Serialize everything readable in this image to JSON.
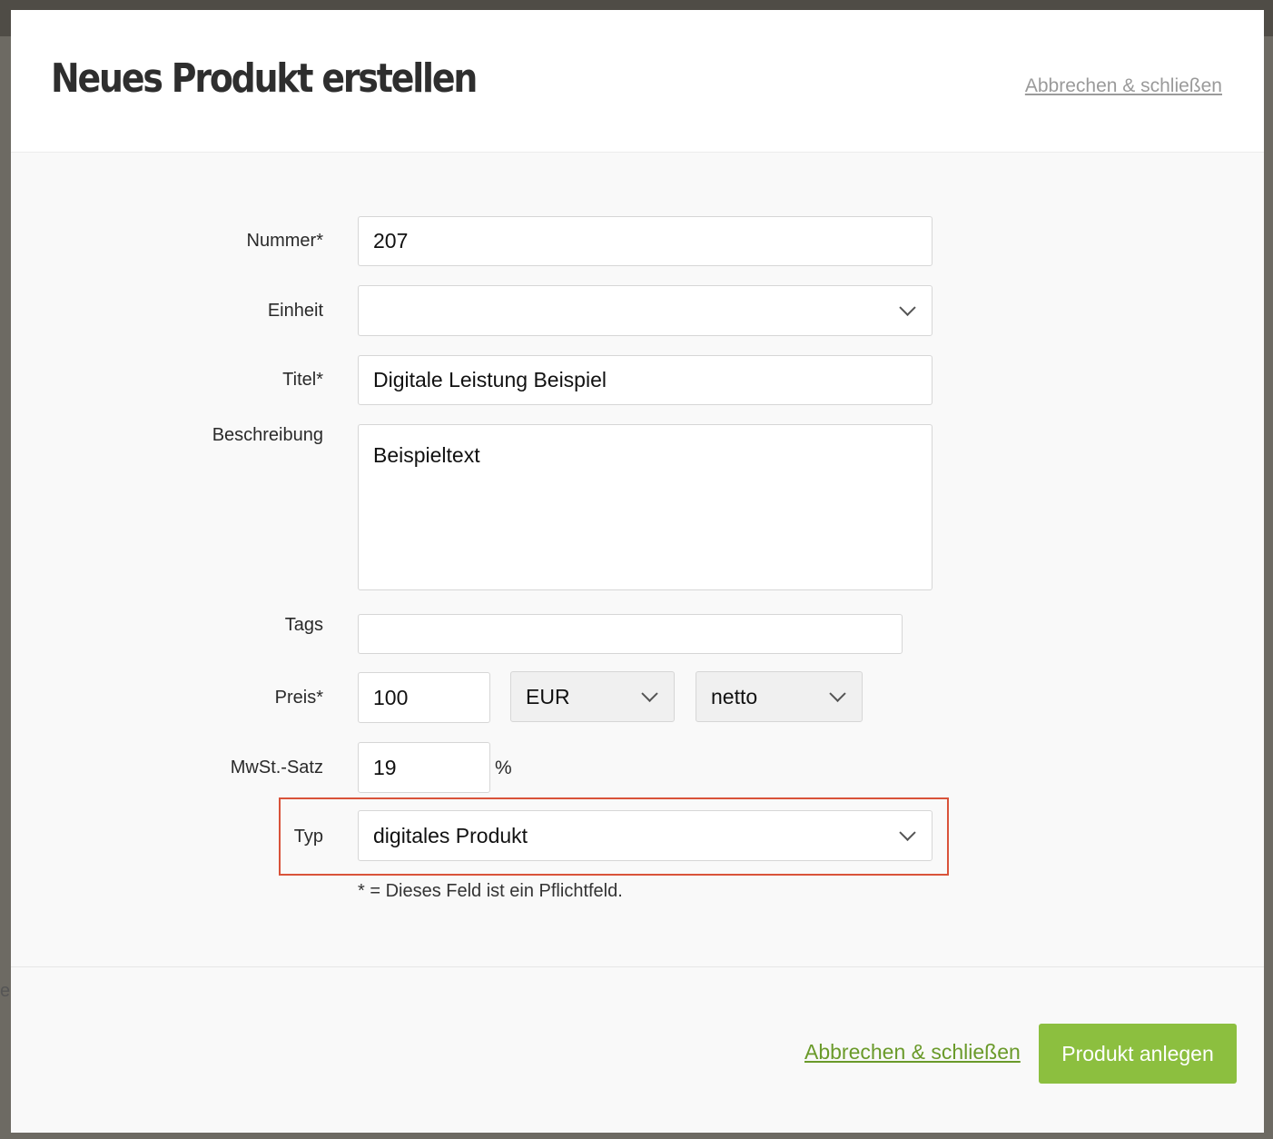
{
  "modal": {
    "title": "Neues Produkt erstellen",
    "header_cancel": "Abbrechen & schließen"
  },
  "form": {
    "nummer": {
      "label": "Nummer*",
      "value": "207"
    },
    "einheit": {
      "label": "Einheit",
      "value": ""
    },
    "titel": {
      "label": "Titel*",
      "value": "Digitale Leistung Beispiel"
    },
    "beschreibung": {
      "label": "Beschreibung",
      "value": "Beispieltext"
    },
    "tags": {
      "label": "Tags",
      "value": ""
    },
    "preis": {
      "label": "Preis*",
      "value": "100",
      "currency": "EUR",
      "mode": "netto"
    },
    "mwst": {
      "label": "MwSt.-Satz",
      "value": "19",
      "unit": "%"
    },
    "typ": {
      "label": "Typ",
      "value": "digitales Produkt"
    },
    "required_note": "* = Dieses Feld ist ein Pflichtfeld."
  },
  "footer": {
    "cancel": "Abbrechen & schließen",
    "submit": "Produkt anlegen"
  },
  "colors": {
    "accent_green": "#8cbf3f",
    "link_green": "#6a9a2a",
    "highlight_red": "#d9533a"
  }
}
